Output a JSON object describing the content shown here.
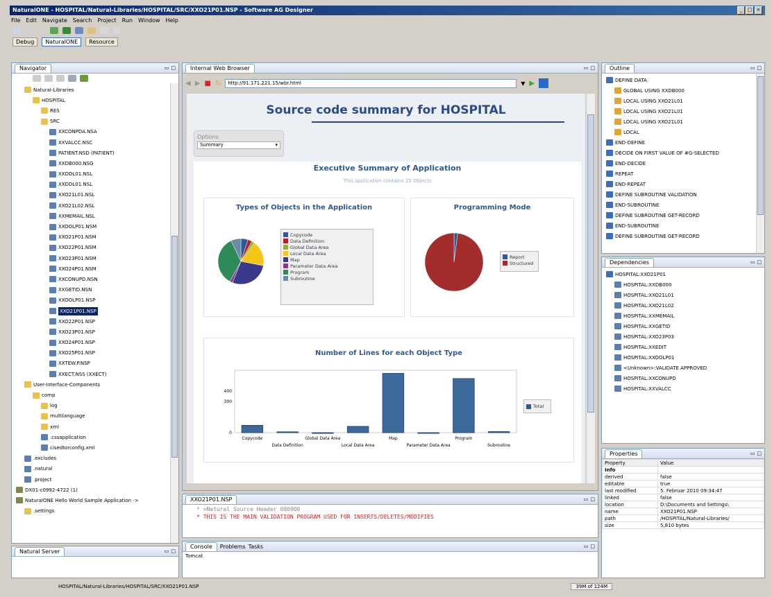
{
  "window": {
    "title": "NaturalONE - HOSPITAL/Natural-Libraries/HOSPITAL/SRC/XXO21P01.NSP - Software AG Designer"
  },
  "menubar": [
    "File",
    "Edit",
    "Navigate",
    "Search",
    "Project",
    "Run",
    "Window",
    "Help"
  ],
  "perspectives": [
    "Debug",
    "NaturalONE",
    "Resource"
  ],
  "navigator": {
    "tab": "Navigator",
    "items": [
      {
        "label": "Natural-Libraries",
        "icon": "folder-icon",
        "indent": 1
      },
      {
        "label": "HOSPITAL",
        "icon": "folder-icon",
        "indent": 2
      },
      {
        "label": "RES",
        "icon": "folder-icon",
        "indent": 3
      },
      {
        "label": "SRC",
        "icon": "folder-icon",
        "indent": 3
      },
      {
        "label": "XXCONPDA.NSA",
        "icon": "file-icon",
        "indent": 4
      },
      {
        "label": "XXVALCC.NSC",
        "icon": "file-icon",
        "indent": 4
      },
      {
        "label": "PATIENT.NSD (PATIENT)",
        "icon": "file-icon",
        "indent": 4
      },
      {
        "label": "XXDB000.NSG",
        "icon": "file-icon",
        "indent": 4
      },
      {
        "label": "XXDDL01.NSL",
        "icon": "file-icon",
        "indent": 4
      },
      {
        "label": "XXDDL01.NSL",
        "icon": "file-icon",
        "indent": 4
      },
      {
        "label": "XXO21L01.NSL",
        "icon": "file-icon",
        "indent": 4
      },
      {
        "label": "XXO21L02.NSL",
        "icon": "file-icon",
        "indent": 4
      },
      {
        "label": "XXMEMAIL.NSL",
        "icon": "file-icon",
        "indent": 4
      },
      {
        "label": "XXOOLP01.NSM",
        "icon": "file-icon",
        "indent": 4
      },
      {
        "label": "XXO21P01.NSM",
        "icon": "file-icon",
        "indent": 4
      },
      {
        "label": "XXO22P01.NSM",
        "icon": "file-icon",
        "indent": 4
      },
      {
        "label": "XXO23P01.NSM",
        "icon": "file-icon",
        "indent": 4
      },
      {
        "label": "XXO24P01.NSM",
        "icon": "file-icon",
        "indent": 4
      },
      {
        "label": "XXCONUPD.NSN",
        "icon": "file-icon",
        "indent": 4
      },
      {
        "label": "XXGETID.NSN",
        "icon": "file-icon",
        "indent": 4
      },
      {
        "label": "XXOOLP01.NSP",
        "icon": "file-icon",
        "indent": 4
      },
      {
        "label": "XXO21P01.NSP",
        "icon": "file-icon",
        "indent": 4,
        "selected": true
      },
      {
        "label": "XXO22P01.NSP",
        "icon": "file-icon",
        "indent": 4
      },
      {
        "label": "XXO23P01.NSP",
        "icon": "file-icon",
        "indent": 4
      },
      {
        "label": "XXO24P01.NSP",
        "icon": "file-icon",
        "indent": 4
      },
      {
        "label": "XXO25P01.NSP",
        "icon": "file-icon",
        "indent": 4
      },
      {
        "label": "XXTEW.P.NSP",
        "icon": "file-icon",
        "indent": 4
      },
      {
        "label": "XXECT.NSS (XXECT)",
        "icon": "file-icon",
        "indent": 4
      },
      {
        "label": "User-Interface-Components",
        "icon": "folder-icon",
        "indent": 1
      },
      {
        "label": "comp",
        "icon": "folder-icon",
        "indent": 2
      },
      {
        "label": "log",
        "icon": "folder-icon",
        "indent": 3
      },
      {
        "label": "multilanguage",
        "icon": "folder-icon",
        "indent": 3
      },
      {
        "label": "xml",
        "icon": "folder-icon",
        "indent": 3
      },
      {
        "label": ".cssapplication",
        "icon": "file-icon",
        "indent": 3
      },
      {
        "label": "cisedtorconfig.xml",
        "icon": "file-icon",
        "indent": 3
      },
      {
        "label": ".excludes",
        "icon": "file-icon",
        "indent": 1
      },
      {
        "label": ".natural",
        "icon": "file-icon",
        "indent": 1
      },
      {
        "label": ".project",
        "icon": "file-icon",
        "indent": 1
      },
      {
        "label": "DX01-c0992-4722 (1)",
        "icon": "project-icon",
        "indent": 0
      },
      {
        "label": "NaturalONE Hello World Sample Application ->",
        "icon": "project-icon",
        "indent": 0
      },
      {
        "label": ".settings",
        "icon": "folder-icon",
        "indent": 1
      }
    ]
  },
  "naturalServer": {
    "tab": "Natural Server"
  },
  "browser": {
    "tab": "Internal Web Browser",
    "url": "http://91.171.221.15/wbr.html",
    "page_title": "Source code summary for HOSPITAL",
    "options_label": "Options",
    "options_value": "Summary",
    "exec_title": "Executive Summary of Application",
    "exec_subtitle": "This application contains 25 Objects",
    "types_title": "Types of Objects in the Application",
    "mode_title": "Programming Mode",
    "lines_title": "Number of Lines for each Object Type",
    "types_legend": [
      {
        "name": "Copycode",
        "color": "#2a5a9a"
      },
      {
        "name": "Data Definition",
        "color": "#b22222"
      },
      {
        "name": "Global Data Area",
        "color": "#8fae3a"
      },
      {
        "name": "Local Data Area",
        "color": "#f5c518"
      },
      {
        "name": "Map",
        "color": "#3a3a8c"
      },
      {
        "name": "Parameter Data Area",
        "color": "#8a3a8a"
      },
      {
        "name": "Program",
        "color": "#2e8b57"
      },
      {
        "name": "Subroutine",
        "color": "#6a8aa8"
      }
    ],
    "mode_legend": [
      {
        "name": "Report",
        "color": "#2a5a9a"
      },
      {
        "name": "Structured",
        "color": "#a32d2d"
      }
    ],
    "lines_legend": "Total"
  },
  "chart_data": [
    {
      "type": "pie",
      "title": "Types of Objects in the Application",
      "categories": [
        "Copycode",
        "Data Definition",
        "Global Data Area",
        "Local Data Area",
        "Map",
        "Parameter Data Area",
        "Program",
        "Subroutine"
      ],
      "values": [
        5,
        3,
        2,
        18,
        28,
        2,
        35,
        7
      ]
    },
    {
      "type": "pie",
      "title": "Programming Mode",
      "categories": [
        "Report",
        "Structured"
      ],
      "values": [
        2,
        98
      ]
    },
    {
      "type": "bar",
      "title": "Number of Lines for each Object Type",
      "categories": [
        "Copycode",
        "Data Definition",
        "Global Data Area",
        "Local Data Area",
        "Map",
        "Parameter Data Area",
        "Program",
        "Subroutine"
      ],
      "series": [
        {
          "name": "Total",
          "values": [
            70,
            8,
            0,
            60,
            570,
            0,
            520,
            10
          ]
        }
      ],
      "yticks": [
        "0",
        "300",
        "400"
      ],
      "ylim": [
        0,
        600
      ]
    }
  ],
  "editor": {
    "tab": "XXO21P01.NSP",
    "lines": [
      "* >Natural Source Header 000000",
      "* THIS IS THE MAIN VALIDATION PROGRAM USED FOR INSERTS/DELETES/MODIFIES"
    ]
  },
  "console": {
    "tabs": [
      "Console",
      "Problems",
      "Tasks"
    ],
    "text": "Tomcat"
  },
  "outline": {
    "tab": "Outline",
    "items": [
      {
        "label": "DEFINE DATA",
        "indent": 0
      },
      {
        "label": "GLOBAL USING XXDB000",
        "indent": 1
      },
      {
        "label": "LOCAL USING XXO21L01",
        "indent": 1
      },
      {
        "label": "LOCAL USING XXO21L01",
        "indent": 1
      },
      {
        "label": "LOCAL USING XXO21L01",
        "indent": 1
      },
      {
        "label": "LOCAL",
        "indent": 1
      },
      {
        "label": "END-DEFINE",
        "indent": 0
      },
      {
        "label": "DECIDE ON FIRST VALUE OF #G-SELECTED",
        "indent": 0
      },
      {
        "label": "END-DECIDE",
        "indent": 0
      },
      {
        "label": "REPEAT",
        "indent": 0
      },
      {
        "label": "END-REPEAT",
        "indent": 0
      },
      {
        "label": "DEFINE SUBROUTINE VALIDATION",
        "indent": 0
      },
      {
        "label": "END-SUBROUTINE",
        "indent": 0
      },
      {
        "label": "DEFINE SUBROUTINE GET-RECORD",
        "indent": 0
      },
      {
        "label": "END-SUBROUTINE",
        "indent": 0
      },
      {
        "label": "DEFINE SUBROUTINE GET-RECORD",
        "indent": 0
      }
    ]
  },
  "dependencies": {
    "tab": "Dependencies",
    "items": [
      {
        "label": "HOSPITAL:XXO21P01",
        "indent": 0
      },
      {
        "label": "HOSPITAL:XXDB000",
        "indent": 1
      },
      {
        "label": "HOSPITAL:XXO21L01",
        "indent": 1
      },
      {
        "label": "HOSPITAL:XXO21L02",
        "indent": 1
      },
      {
        "label": "HOSPITAL:XXMEMAIL",
        "indent": 1
      },
      {
        "label": "HOSPITAL:XXGETID",
        "indent": 1
      },
      {
        "label": "HOSPITAL:XXO23P03",
        "indent": 1
      },
      {
        "label": "HOSPITAL:XXEDIT",
        "indent": 1
      },
      {
        "label": "HOSPITAL:XXOOLP01",
        "indent": 1
      },
      {
        "label": "<Unknown>:VALIDATE APPROVED",
        "indent": 1
      },
      {
        "label": "HOSPITAL:XXCONUPD",
        "indent": 1
      },
      {
        "label": "HOSPITAL:XXVALCC",
        "indent": 1
      }
    ]
  },
  "properties": {
    "tab": "Properties",
    "header": [
      "Property",
      "Value"
    ],
    "rows": [
      [
        "Info",
        ""
      ],
      [
        "derived",
        "false"
      ],
      [
        "editable",
        "true"
      ],
      [
        "last modified",
        "5. Februar 2010 09:34:47"
      ],
      [
        "linked",
        "false"
      ],
      [
        "location",
        "D:\\Documents and Settings\\"
      ],
      [
        "name",
        "XXO21P01.NSP"
      ],
      [
        "path",
        "/HOSPITAL/Natural-Libraries/"
      ],
      [
        "size",
        "5,810 bytes"
      ]
    ]
  },
  "status": {
    "path": "HOSPITAL/Natural-Libraries/HOSPITAL/SRC/XXO21P01.NSP",
    "memory": "39M of 124M"
  }
}
